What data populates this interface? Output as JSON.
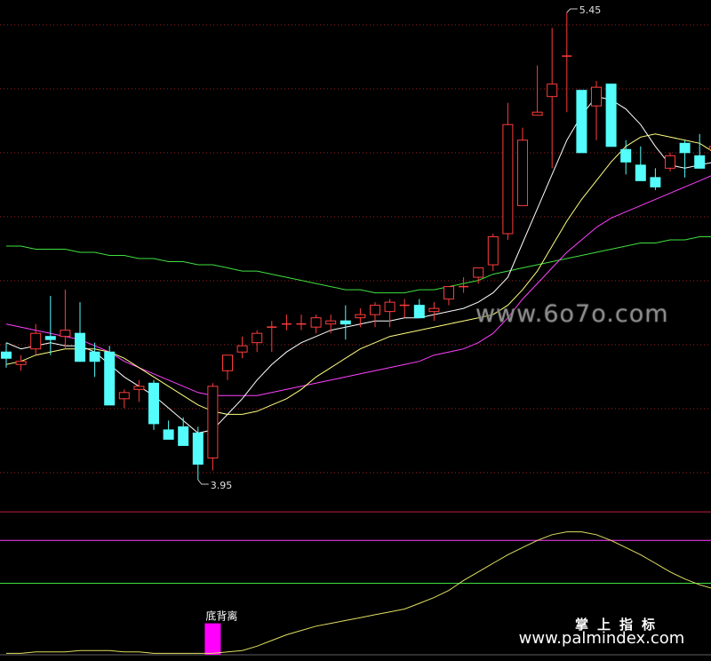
{
  "chart_data": [
    {
      "type": "candlestick",
      "title": "",
      "price_labels": {
        "high": "5.45",
        "low": "3.95"
      },
      "colors": {
        "up": "#ff3c3c",
        "down": "#54fcfc",
        "ma_fast": "#ffffff",
        "ma_mid": "#ffff80",
        "ma_long": "#ff40ff",
        "ma_slow": "#40e040",
        "grid": "#a02020"
      },
      "ohlc": [
        [
          4.36,
          4.39,
          4.31,
          4.34
        ],
        [
          4.32,
          4.35,
          4.3,
          4.33
        ],
        [
          4.37,
          4.45,
          4.35,
          4.42
        ],
        [
          4.41,
          4.54,
          4.35,
          4.4
        ],
        [
          4.41,
          4.56,
          4.37,
          4.43
        ],
        [
          4.42,
          4.52,
          4.34,
          4.33
        ],
        [
          4.36,
          4.39,
          4.28,
          4.33
        ],
        [
          4.36,
          4.38,
          4.19,
          4.19
        ],
        [
          4.21,
          4.24,
          4.18,
          4.23
        ],
        [
          4.24,
          4.27,
          4.2,
          4.25
        ],
        [
          4.26,
          4.27,
          4.11,
          4.13
        ],
        [
          4.11,
          4.14,
          4.08,
          4.08
        ],
        [
          4.12,
          4.15,
          4.07,
          4.06
        ],
        [
          4.1,
          4.12,
          3.95,
          4.0
        ],
        [
          4.02,
          4.26,
          3.98,
          4.25
        ],
        [
          4.3,
          4.34,
          4.27,
          4.35
        ],
        [
          4.36,
          4.41,
          4.34,
          4.38
        ],
        [
          4.39,
          4.43,
          4.36,
          4.42
        ],
        [
          4.44,
          4.46,
          4.36,
          4.44
        ],
        [
          4.45,
          4.48,
          4.43,
          4.45
        ],
        [
          4.45,
          4.48,
          4.43,
          4.45
        ],
        [
          4.44,
          4.48,
          4.42,
          4.47
        ],
        [
          4.45,
          4.48,
          4.42,
          4.46
        ],
        [
          4.46,
          4.51,
          4.4,
          4.45
        ],
        [
          4.47,
          4.5,
          4.44,
          4.48
        ],
        [
          4.48,
          4.52,
          4.44,
          4.51
        ],
        [
          4.49,
          4.53,
          4.44,
          4.52
        ],
        [
          4.51,
          4.53,
          4.47,
          4.51
        ],
        [
          4.51,
          4.53,
          4.48,
          4.47
        ],
        [
          4.49,
          4.52,
          4.46,
          4.5
        ],
        [
          4.53,
          4.56,
          4.51,
          4.57
        ],
        [
          4.57,
          4.6,
          4.55,
          4.57
        ],
        [
          4.6,
          4.62,
          4.58,
          4.63
        ],
        [
          4.64,
          4.74,
          4.62,
          4.73
        ],
        [
          4.74,
          5.16,
          4.72,
          5.09
        ],
        [
          4.83,
          5.08,
          4.84,
          5.04
        ],
        [
          5.12,
          5.28,
          5.12,
          5.13
        ],
        [
          5.18,
          5.4,
          4.95,
          5.22
        ],
        [
          5.31,
          5.45,
          5.13,
          5.31
        ],
        [
          5.2,
          5.16,
          5.09,
          5.0
        ],
        [
          5.15,
          5.23,
          5.04,
          5.21
        ],
        [
          5.22,
          5.16,
          5.09,
          5.02
        ],
        [
          5.01,
          5.04,
          4.93,
          4.97
        ],
        [
          4.96,
          5.02,
          4.91,
          4.91
        ],
        [
          4.92,
          4.95,
          4.88,
          4.89
        ],
        [
          4.95,
          5.0,
          4.94,
          4.99
        ],
        [
          5.03,
          5.04,
          4.92,
          5.0
        ],
        [
          4.99,
          5.06,
          4.96,
          4.95
        ],
        [
          5.01,
          5.14,
          4.97,
          5.02
        ],
        [
          5.02,
          5.22,
          5.0,
          5.04
        ],
        [
          4.98,
          5.05,
          4.96,
          4.97
        ]
      ],
      "ma_fast": [
        4.39,
        4.37,
        4.38,
        4.39,
        4.38,
        4.38,
        4.36,
        4.32,
        4.28,
        4.25,
        4.22,
        4.18,
        4.14,
        4.1,
        4.11,
        4.16,
        4.21,
        4.27,
        4.32,
        4.36,
        4.39,
        4.41,
        4.43,
        4.44,
        4.45,
        4.46,
        4.46,
        4.47,
        4.47,
        4.48,
        4.49,
        4.5,
        4.52,
        4.55,
        4.6,
        4.71,
        4.82,
        4.93,
        5.04,
        5.12,
        5.18,
        5.17,
        5.14,
        5.09,
        5.02,
        4.96,
        4.95,
        4.96,
        4.97,
        4.97,
        4.99
      ],
      "ma_mid": [
        4.32,
        4.33,
        4.35,
        4.36,
        4.37,
        4.37,
        4.37,
        4.36,
        4.34,
        4.31,
        4.28,
        4.25,
        4.22,
        4.19,
        4.17,
        4.16,
        4.16,
        4.17,
        4.19,
        4.21,
        4.24,
        4.28,
        4.31,
        4.34,
        4.37,
        4.39,
        4.41,
        4.42,
        4.43,
        4.44,
        4.45,
        4.46,
        4.47,
        4.48,
        4.51,
        4.56,
        4.62,
        4.7,
        4.78,
        4.85,
        4.91,
        4.97,
        5.02,
        5.05,
        5.06,
        5.05,
        5.04,
        5.03,
        5.0,
        4.98,
        4.97
      ],
      "ma_long": [
        4.45,
        4.44,
        4.43,
        4.42,
        4.41,
        4.4,
        4.38,
        4.36,
        4.33,
        4.31,
        4.29,
        4.27,
        4.25,
        4.23,
        4.22,
        4.22,
        4.22,
        4.22,
        4.23,
        4.24,
        4.25,
        4.26,
        4.27,
        4.28,
        4.29,
        4.3,
        4.31,
        4.32,
        4.33,
        4.35,
        4.36,
        4.37,
        4.39,
        4.42,
        4.47,
        4.53,
        4.58,
        4.63,
        4.68,
        4.72,
        4.76,
        4.79,
        4.81,
        4.83,
        4.85,
        4.87,
        4.89,
        4.91,
        4.93,
        4.95,
        4.97
      ],
      "ma_slow": [
        4.7,
        4.7,
        4.69,
        4.69,
        4.69,
        4.68,
        4.68,
        4.67,
        4.67,
        4.66,
        4.66,
        4.65,
        4.65,
        4.64,
        4.64,
        4.63,
        4.62,
        4.62,
        4.61,
        4.6,
        4.59,
        4.58,
        4.57,
        4.56,
        4.56,
        4.55,
        4.55,
        4.55,
        4.56,
        4.56,
        4.57,
        4.58,
        4.59,
        4.61,
        4.62,
        4.63,
        4.64,
        4.65,
        4.66,
        4.67,
        4.68,
        4.69,
        4.7,
        4.71,
        4.71,
        4.72,
        4.72,
        4.73,
        4.73,
        4.74,
        4.74
      ]
    },
    {
      "type": "line",
      "signal_label": "底背离",
      "signal_index": 14,
      "signal_color": "#ff00ff",
      "line_color": "#e0e060",
      "ref_lines": [
        {
          "level": 100,
          "color": "#c02040"
        },
        {
          "level": 80,
          "color": "#ff40ff"
        },
        {
          "level": 50,
          "color": "#40e040"
        }
      ],
      "ylim": [
        0,
        110
      ],
      "values": [
        1,
        1,
        2,
        2,
        2,
        3,
        3,
        3,
        2,
        2,
        1,
        1,
        1,
        1,
        1,
        2,
        3,
        6,
        10,
        14,
        17,
        20,
        22,
        24,
        26,
        28,
        30,
        32,
        36,
        40,
        45,
        52,
        58,
        64,
        70,
        75,
        80,
        84,
        86,
        86,
        84,
        80,
        75,
        70,
        64,
        58,
        53,
        49,
        46,
        44,
        43
      ]
    }
  ],
  "watermark": {
    "mid": "www.6o7o.com",
    "cn": "掌上指标",
    "url": "www.palmindex.com"
  }
}
